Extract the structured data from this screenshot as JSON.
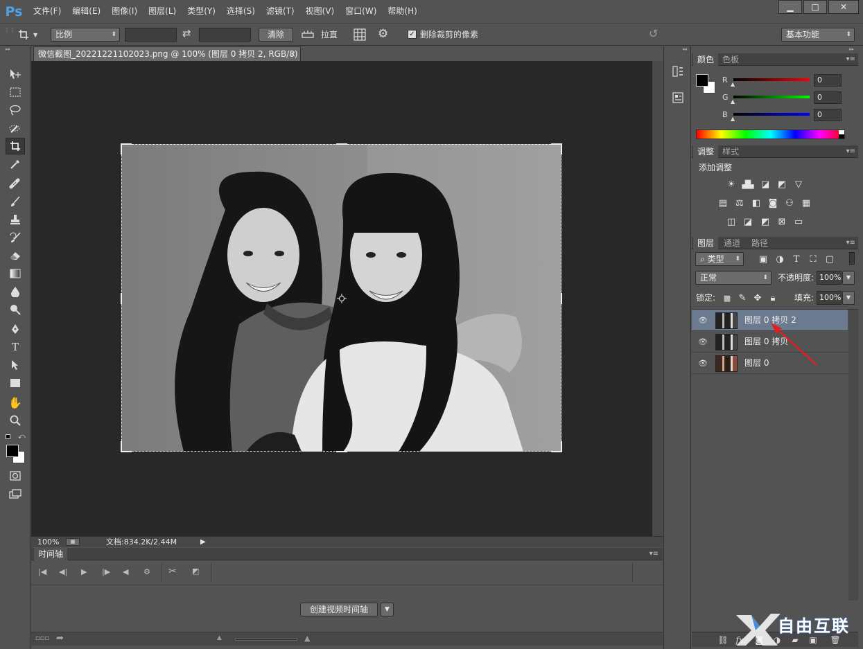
{
  "app": {
    "logo": "Ps"
  },
  "menu": [
    "文件(F)",
    "编辑(E)",
    "图像(I)",
    "图层(L)",
    "类型(Y)",
    "选择(S)",
    "滤镜(T)",
    "视图(V)",
    "窗口(W)",
    "帮助(H)"
  ],
  "window_controls": {
    "minimize": "▁",
    "maximize": "□",
    "close": "✕"
  },
  "options": {
    "ratio_select": "比例",
    "swap_glyph": "⇄",
    "clear_button": "清除",
    "straighten_label": "拉直",
    "delete_cropped_label": "删除裁剪的像素",
    "delete_cropped_checked": true,
    "workspace_select": "基本功能"
  },
  "document": {
    "tab_title": "微信截图_20221221102023.png @ 100% (图层 0 拷贝 2, RGB/8) *",
    "close_glyph": "×"
  },
  "status": {
    "zoom": "100%",
    "doc_info": "文档:834.2K/2.44M"
  },
  "timeline": {
    "title": "时间轴",
    "create_button": "创建视频时间轴"
  },
  "color_panel": {
    "tabs": [
      "颜色",
      "色板"
    ],
    "channels": [
      {
        "label": "R",
        "value": "0"
      },
      {
        "label": "G",
        "value": "0"
      },
      {
        "label": "B",
        "value": "0"
      }
    ]
  },
  "adjust_panel": {
    "tabs": [
      "调整",
      "样式"
    ],
    "heading": "添加调整"
  },
  "layers_panel": {
    "tabs": [
      "图层",
      "通道",
      "路径"
    ],
    "filter_select": "类型",
    "blend_mode": "正常",
    "opacity_label": "不透明度:",
    "opacity_value": "100%",
    "lock_label": "锁定:",
    "fill_label": "填充:",
    "fill_value": "100%",
    "layers": [
      {
        "name": "图层 0 拷贝 2",
        "selected": true,
        "color": false
      },
      {
        "name": "图层 0 拷贝",
        "selected": false,
        "color": false
      },
      {
        "name": "图层 0",
        "selected": false,
        "color": true
      }
    ],
    "footer_fx": "fx."
  },
  "watermark": {
    "text": "自由互联"
  },
  "colors": {
    "accent": "#4fa3e8",
    "selection": "#6b7a8e",
    "annotation_arrow": "#e02020"
  }
}
